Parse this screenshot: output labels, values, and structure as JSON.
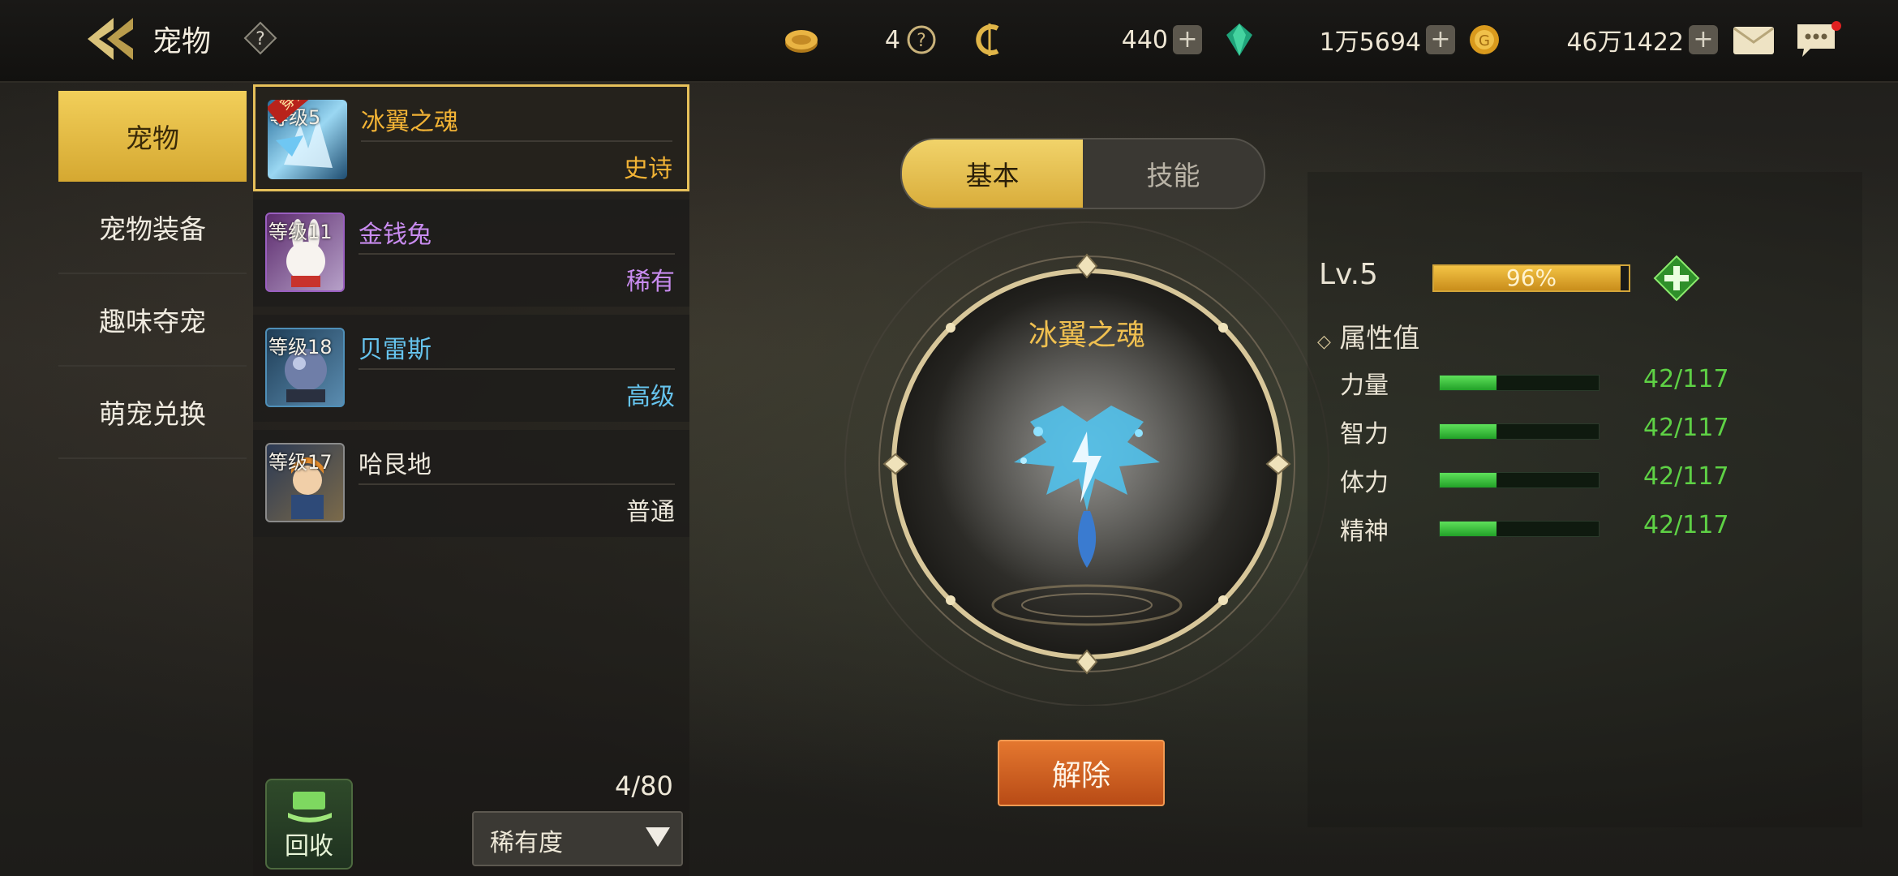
{
  "header": {
    "title": "宠物",
    "currencies": [
      {
        "icon": "coin-token-icon",
        "value": "4"
      },
      {
        "icon": "c-currency-icon",
        "value": "440"
      },
      {
        "icon": "green-gem-icon",
        "value": "1万5694"
      },
      {
        "icon": "gold-coin-icon",
        "value": "46万1422"
      }
    ]
  },
  "nav": {
    "items": [
      {
        "label": "宠物",
        "active": true
      },
      {
        "label": "宠物装备",
        "active": false
      },
      {
        "label": "趣味夺宠",
        "active": false
      },
      {
        "label": "萌宠兑换",
        "active": false
      }
    ]
  },
  "pets": [
    {
      "level": "等级5",
      "name": "冰翼之魂",
      "rarity": "史诗",
      "name_color": "#f2b335",
      "rarity_color": "#f2b335",
      "badge": "穿戴中",
      "selected": true
    },
    {
      "level": "等级11",
      "name": "金钱兔",
      "rarity": "稀有",
      "name_color": "#c98cf0",
      "rarity_color": "#c98cf0",
      "selected": false
    },
    {
      "level": "等级18",
      "name": "贝雷斯",
      "rarity": "高级",
      "name_color": "#66c4ee",
      "rarity_color": "#66c4ee",
      "selected": false
    },
    {
      "level": "等级17",
      "name": "哈艮地",
      "rarity": "普通",
      "name_color": "#ece7db",
      "rarity_color": "#ece7db",
      "selected": false
    }
  ],
  "list_footer": {
    "recycle_label": "回收",
    "count": "4/80",
    "sort_label": "稀有度"
  },
  "tabs": [
    {
      "label": "基本",
      "active": true
    },
    {
      "label": "技能",
      "active": false
    }
  ],
  "detail": {
    "pet_name": "冰翼之魂",
    "level": "Lv.5",
    "exp_percent_text": "96%",
    "exp_fraction": 0.96,
    "attr_title": "属性值",
    "attributes": [
      {
        "label": "力量",
        "value": "42/117",
        "fraction": 0.359
      },
      {
        "label": "智力",
        "value": "42/117",
        "fraction": 0.359
      },
      {
        "label": "体力",
        "value": "42/117",
        "fraction": 0.359
      },
      {
        "label": "精神",
        "value": "42/117",
        "fraction": 0.359
      }
    ],
    "release_label": "解除"
  }
}
